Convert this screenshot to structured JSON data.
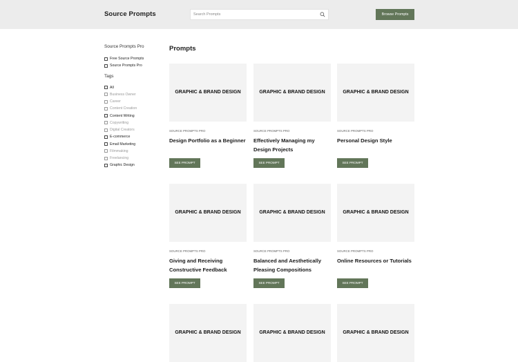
{
  "header": {
    "brand": "Source Prompts",
    "search_placeholder": "Search Prompts",
    "browse_label": "Browse Prompts"
  },
  "sidebar": {
    "group1_heading": "Source Prompts Pro",
    "group1_items": [
      {
        "label": "Free Source Prompts",
        "muted": false
      },
      {
        "label": "Source Prompts Pro",
        "muted": false
      }
    ],
    "tags_heading": "Tags",
    "tags": [
      {
        "label": "All",
        "muted": false
      },
      {
        "label": "Business Owner",
        "muted": true
      },
      {
        "label": "Career",
        "muted": true
      },
      {
        "label": "Content Creation",
        "muted": true
      },
      {
        "label": "Content Writing",
        "muted": false
      },
      {
        "label": "Copywriting",
        "muted": true
      },
      {
        "label": "Digital Creators",
        "muted": true
      },
      {
        "label": "E-commerce",
        "muted": false
      },
      {
        "label": "Email Marketing",
        "muted": false
      },
      {
        "label": "Filmmaking",
        "muted": true
      },
      {
        "label": "Freelancing",
        "muted": true
      },
      {
        "label": "Graphic Design",
        "muted": false
      }
    ]
  },
  "main": {
    "title": "Prompts",
    "cards": [
      {
        "thumb": "GRAPHIC & BRAND DESIGN",
        "category": "SOURCE PROMPTS PRO",
        "title": "Design Portfolio as a Beginner",
        "button": "SEE PROMPT"
      },
      {
        "thumb": "GRAPHIC & BRAND DESIGN",
        "category": "SOURCE PROMPTS PRO",
        "title": "Effectively Managing my Design Projects",
        "button": "SEE PROMPT"
      },
      {
        "thumb": "GRAPHIC & BRAND DESIGN",
        "category": "SOURCE PROMPTS PRO",
        "title": "Personal Design Style",
        "button": "SEE PROMPT"
      },
      {
        "thumb": "GRAPHIC & BRAND DESIGN",
        "category": "SOURCE PROMPTS PRO",
        "title": "Giving and Receiving Constructive Feedback",
        "button": "SEE PROMPT"
      },
      {
        "thumb": "GRAPHIC & BRAND DESIGN",
        "category": "SOURCE PROMPTS PRO",
        "title": "Balanced and Aesthetically Pleasing Compositions",
        "button": "SEE PROMPT"
      },
      {
        "thumb": "GRAPHIC & BRAND DESIGN",
        "category": "SOURCE PROMPTS PRO",
        "title": "Online Resources or Tutorials",
        "button": "SEE PROMPT"
      },
      {
        "thumb": "GRAPHIC & BRAND DESIGN"
      },
      {
        "thumb": "GRAPHIC & BRAND DESIGN"
      },
      {
        "thumb": "GRAPHIC & BRAND DESIGN"
      }
    ]
  }
}
